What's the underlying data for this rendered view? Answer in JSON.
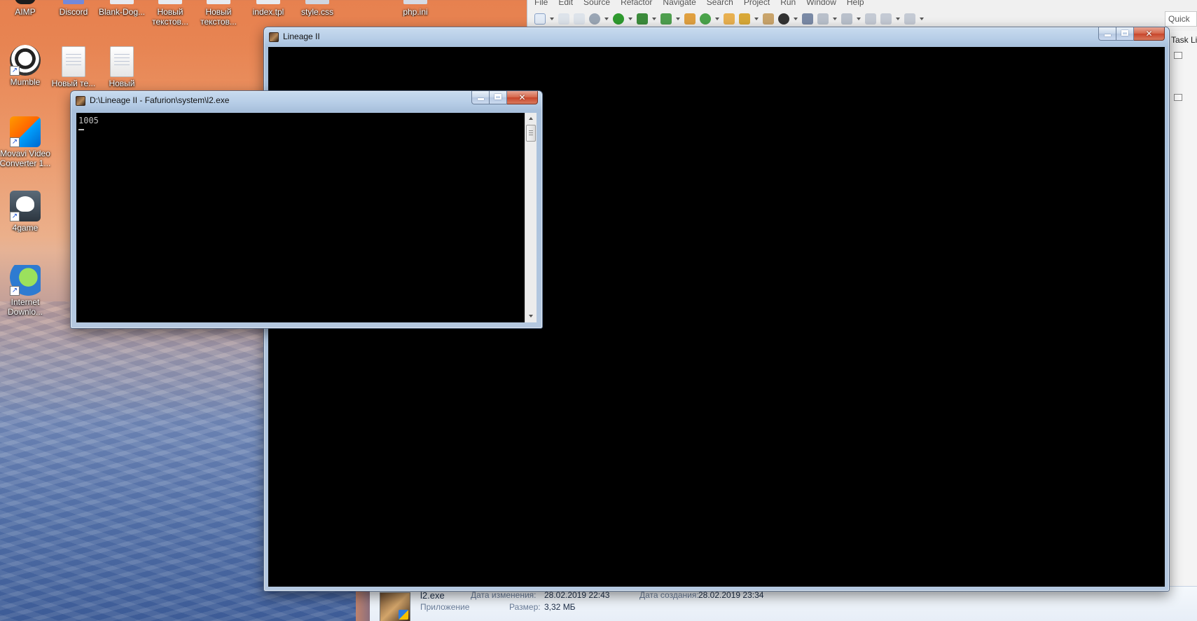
{
  "desktop": {
    "icons": [
      {
        "label": "AIMP"
      },
      {
        "label": "Discord"
      },
      {
        "label": "Blank-Dog..."
      },
      {
        "label": "Новый текстов..."
      },
      {
        "label": "Новый текстов..."
      },
      {
        "label": "index.tpl"
      },
      {
        "label": "style.css"
      },
      {
        "label": "php.ini"
      },
      {
        "label": "Mumble"
      },
      {
        "label": "Новый те..."
      },
      {
        "label": "Новый"
      },
      {
        "label": "Movavi Video Converter 1..."
      },
      {
        "label": "4game"
      },
      {
        "label": "Internet Downlo..."
      }
    ]
  },
  "ide": {
    "menu": [
      "File",
      "Edit",
      "Source",
      "Refactor",
      "Navigate",
      "Search",
      "Project",
      "Run",
      "Window",
      "Help"
    ],
    "quick_access": "Quick",
    "task_list": "Task Lis"
  },
  "details_bar": {
    "file_name": "l2.exe",
    "file_type": "Приложение",
    "modified_label": "Дата изменения:",
    "modified_value": "28.02.2019 22:43",
    "size_label": "Размер:",
    "size_value": "3,32 МБ",
    "created_label": "Дата создания:",
    "created_value": "28.02.2019 23:34"
  },
  "lineage_window": {
    "title": "Lineage II"
  },
  "console_window": {
    "title": "D:\\Lineage II - Fafurion\\system\\l2.exe",
    "output": "1005"
  },
  "colors": {
    "console_bg": "#000000",
    "console_fg": "#c0c0c0",
    "close_button": "#c8452b",
    "titlebar": "#b5cce6"
  }
}
